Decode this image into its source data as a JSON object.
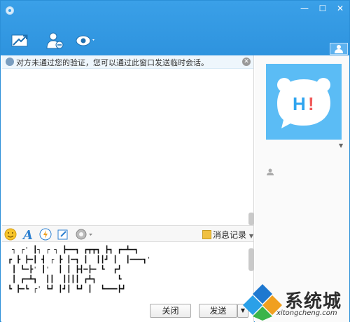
{
  "window": {
    "controls": {
      "minimize": "—",
      "maximize": "☐",
      "close": "✕"
    }
  },
  "toolbar": {
    "icons": [
      "send-file-icon",
      "contact-icon",
      "app-menu-icon"
    ]
  },
  "notice": {
    "text": "对方未通过您的验证，您可以通过此窗口发送临时会话。",
    "close": "✕"
  },
  "editbar": {
    "history_label": "消息记录",
    "icons": [
      "emoji-icon",
      "font-icon",
      "shake-icon",
      "screenshot-icon",
      "settings-icon"
    ]
  },
  "input": {
    "art_lines": [
      " ┐ ┌' ┃┐ ┌ ┐ ┣━━┓ ┏┳┳┓ ┣┓ ┏━┻━┓",
      "┏ ┣ ┣━┃ ┫ ┌ ┣ ┃━┓ ┃  ┃┃┛ ┃  ┃━━━┓'",
      " ┃ ┗━┣' ┃'  ┃ ┃ ┣┫━┣━ ┗  ┏┛",
      " ┃ ┏━┻┓  ┃┃  ┃┃┃┃ ┏┻┓     ┗",
      "┗ ┣━┗ ┌' ┗┛ ┃┛┃ ┗┛ ┃  ┗━━━┣┛"
    ]
  },
  "buttons": {
    "close_label": "关闭",
    "send_label": "发送",
    "send_arrow": "▼"
  },
  "watermark": {
    "big": "系统城",
    "small": "xitongcheng.com"
  },
  "colors": {
    "title_bar": "#3aa0e8",
    "avatar_bg": "#5bbcf5",
    "window_border": "#2b8fd8"
  }
}
